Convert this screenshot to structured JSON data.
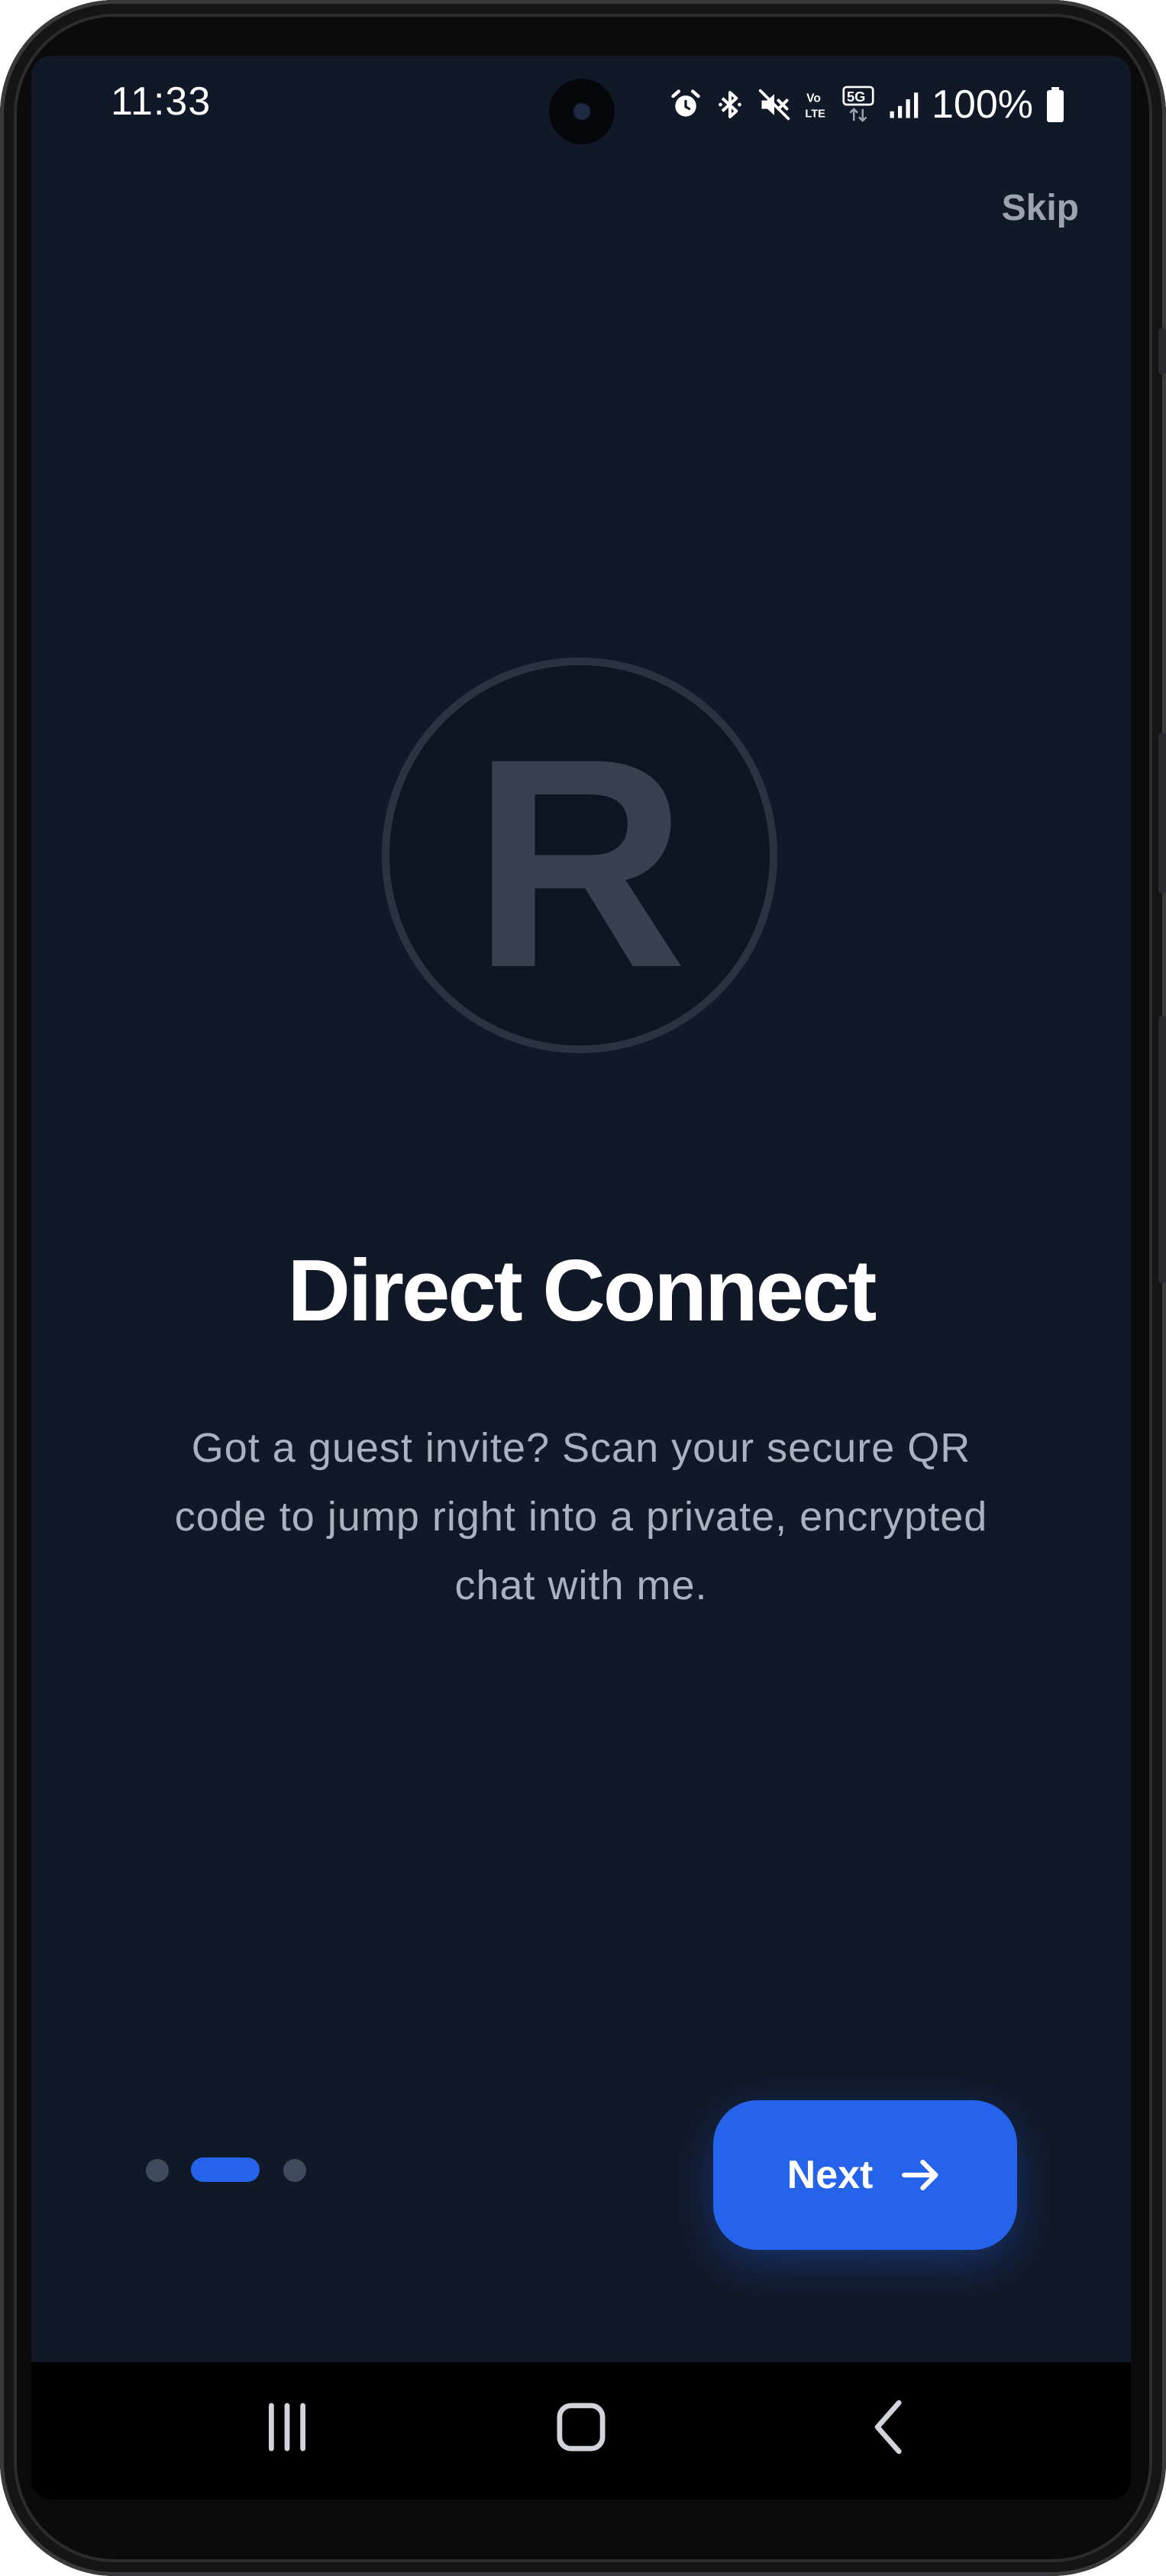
{
  "status_bar": {
    "time": "11:33",
    "network": "5G",
    "battery": "100%",
    "icons": [
      "alarm-icon",
      "bluetooth-icon",
      "mute-icon",
      "volte-icon",
      "5g-icon",
      "signal-icon",
      "battery-icon"
    ]
  },
  "header": {
    "skip_label": "Skip"
  },
  "logo": {
    "letter": "R",
    "color": "#374151"
  },
  "slide": {
    "title": "Direct Connect",
    "description": "Got a guest invite? Scan your secure QR code to jump right into a private, encrypted chat with me."
  },
  "pagination": {
    "total": 3,
    "active_index": 1
  },
  "footer": {
    "next_label": "Next",
    "next_icon": "arrow-right-icon"
  },
  "nav_bar": {
    "items": [
      "recent-apps-icon",
      "home-icon",
      "back-icon"
    ]
  },
  "colors": {
    "background": "#111827",
    "accent": "#2563eb",
    "muted_text": "#9ca3af",
    "inactive_dot": "#3f4a5c"
  }
}
